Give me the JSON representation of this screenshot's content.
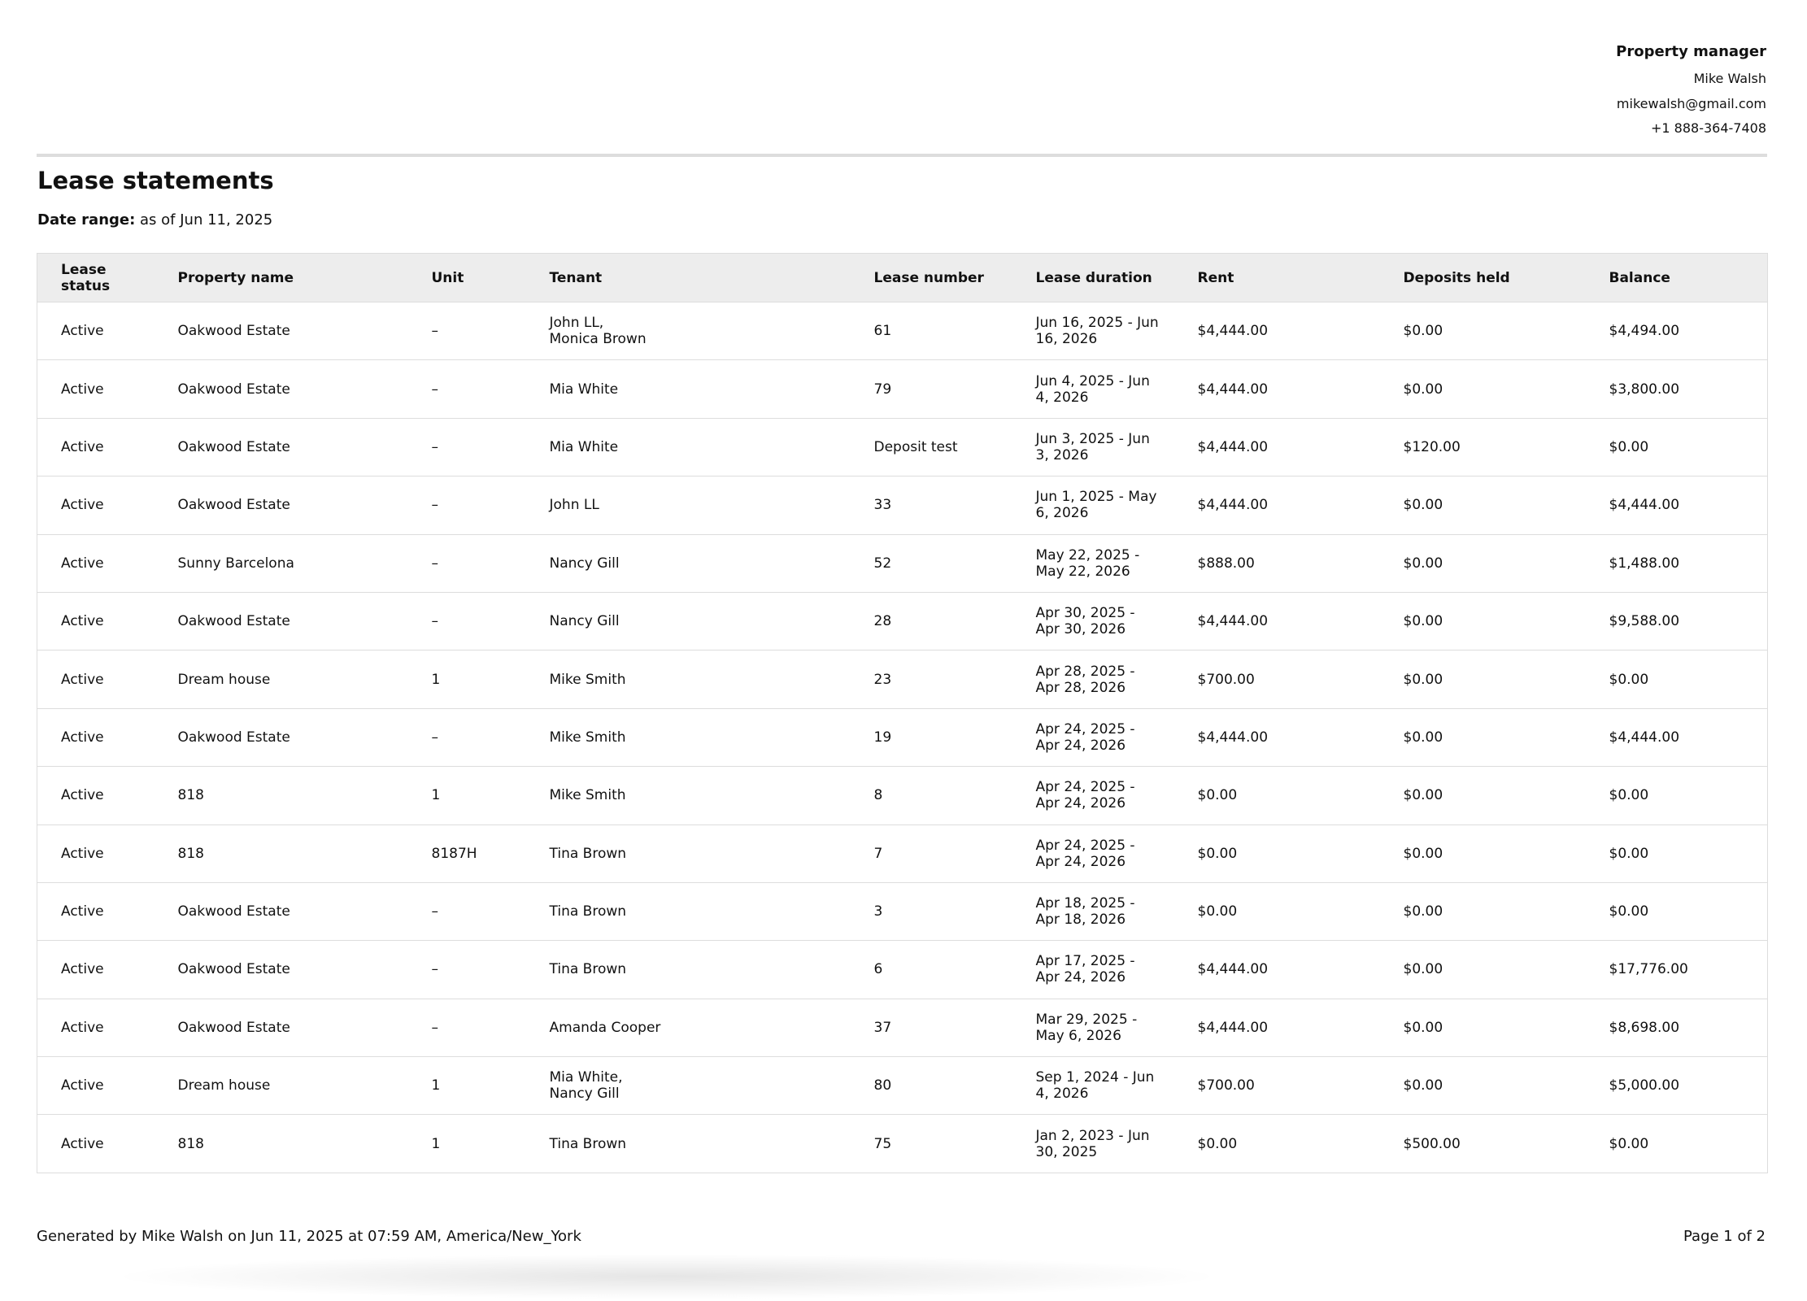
{
  "manager": {
    "heading": "Property manager",
    "name": "Mike Walsh",
    "email": "mikewalsh@gmail.com",
    "phone": "+1 888-364-7408"
  },
  "title": "Lease statements",
  "date_range": {
    "label": "Date range:",
    "value": "as of Jun 11, 2025"
  },
  "columns": [
    "Lease status",
    "Property name",
    "Unit",
    "Tenant",
    "Lease number",
    "Lease duration",
    "Rent",
    "Deposits held",
    "Balance"
  ],
  "rows": [
    {
      "status": "Active",
      "property": "Oakwood Estate",
      "unit": "–",
      "tenant": [
        "John LL,",
        "Monica Brown"
      ],
      "lease_number": "61",
      "duration": "Jun 16, 2025 - Jun 16, 2026",
      "rent": "$4,444.00",
      "deposits": "$0.00",
      "balance": "$4,494.00"
    },
    {
      "status": "Active",
      "property": "Oakwood Estate",
      "unit": "–",
      "tenant": [
        "Mia White"
      ],
      "lease_number": "79",
      "duration": "Jun 4, 2025 - Jun 4, 2026",
      "rent": "$4,444.00",
      "deposits": "$0.00",
      "balance": "$3,800.00"
    },
    {
      "status": "Active",
      "property": "Oakwood Estate",
      "unit": "–",
      "tenant": [
        "Mia White"
      ],
      "lease_number": "Deposit test",
      "duration": "Jun 3, 2025 - Jun 3, 2026",
      "rent": "$4,444.00",
      "deposits": "$120.00",
      "balance": "$0.00"
    },
    {
      "status": "Active",
      "property": "Oakwood Estate",
      "unit": "–",
      "tenant": [
        "John LL"
      ],
      "lease_number": "33",
      "duration": "Jun 1, 2025 - May 6, 2026",
      "rent": "$4,444.00",
      "deposits": "$0.00",
      "balance": "$4,444.00"
    },
    {
      "status": "Active",
      "property": "Sunny Barcelona",
      "unit": "–",
      "tenant": [
        "Nancy Gill"
      ],
      "lease_number": "52",
      "duration": "May 22, 2025 - May 22, 2026",
      "rent": "$888.00",
      "deposits": "$0.00",
      "balance": "$1,488.00"
    },
    {
      "status": "Active",
      "property": "Oakwood Estate",
      "unit": "–",
      "tenant": [
        "Nancy Gill"
      ],
      "lease_number": "28",
      "duration": "Apr 30, 2025 - Apr 30, 2026",
      "rent": "$4,444.00",
      "deposits": "$0.00",
      "balance": "$9,588.00"
    },
    {
      "status": "Active",
      "property": "Dream house",
      "unit": "1",
      "tenant": [
        "Mike Smith"
      ],
      "lease_number": "23",
      "duration": "Apr 28, 2025 - Apr 28, 2026",
      "rent": "$700.00",
      "deposits": "$0.00",
      "balance": "$0.00"
    },
    {
      "status": "Active",
      "property": "Oakwood Estate",
      "unit": "–",
      "tenant": [
        "Mike Smith"
      ],
      "lease_number": "19",
      "duration": "Apr 24, 2025 - Apr 24, 2026",
      "rent": "$4,444.00",
      "deposits": "$0.00",
      "balance": "$4,444.00"
    },
    {
      "status": "Active",
      "property": "818",
      "unit": "1",
      "tenant": [
        "Mike Smith"
      ],
      "lease_number": "8",
      "duration": "Apr 24, 2025 - Apr 24, 2026",
      "rent": "$0.00",
      "deposits": "$0.00",
      "balance": "$0.00"
    },
    {
      "status": "Active",
      "property": "818",
      "unit": "8187H",
      "tenant": [
        "Tina Brown"
      ],
      "lease_number": "7",
      "duration": "Apr 24, 2025 - Apr 24, 2026",
      "rent": "$0.00",
      "deposits": "$0.00",
      "balance": "$0.00"
    },
    {
      "status": "Active",
      "property": "Oakwood Estate",
      "unit": "–",
      "tenant": [
        "Tina Brown"
      ],
      "lease_number": "3",
      "duration": "Apr 18, 2025 - Apr 18, 2026",
      "rent": "$0.00",
      "deposits": "$0.00",
      "balance": "$0.00"
    },
    {
      "status": "Active",
      "property": "Oakwood Estate",
      "unit": "–",
      "tenant": [
        "Tina Brown"
      ],
      "lease_number": "6",
      "duration": "Apr 17, 2025 - Apr 24, 2026",
      "rent": "$4,444.00",
      "deposits": "$0.00",
      "balance": "$17,776.00"
    },
    {
      "status": "Active",
      "property": "Oakwood Estate",
      "unit": "–",
      "tenant": [
        "Amanda Cooper"
      ],
      "lease_number": "37",
      "duration": "Mar 29, 2025 - May 6, 2026",
      "rent": "$4,444.00",
      "deposits": "$0.00",
      "balance": "$8,698.00"
    },
    {
      "status": "Active",
      "property": "Dream house",
      "unit": "1",
      "tenant": [
        "Mia White,",
        "Nancy Gill"
      ],
      "lease_number": "80",
      "duration": "Sep 1, 2024 - Jun 4, 2026",
      "rent": "$700.00",
      "deposits": "$0.00",
      "balance": "$5,000.00"
    },
    {
      "status": "Active",
      "property": "818",
      "unit": "1",
      "tenant": [
        "Tina Brown"
      ],
      "lease_number": "75",
      "duration": "Jan 2, 2023 - Jun 30, 2025",
      "rent": "$0.00",
      "deposits": "$500.00",
      "balance": "$0.00"
    }
  ],
  "footer": {
    "generated": "Generated by Mike Walsh on Jun 11, 2025 at 07:59 AM, America/New_York",
    "page": "Page 1 of 2"
  }
}
